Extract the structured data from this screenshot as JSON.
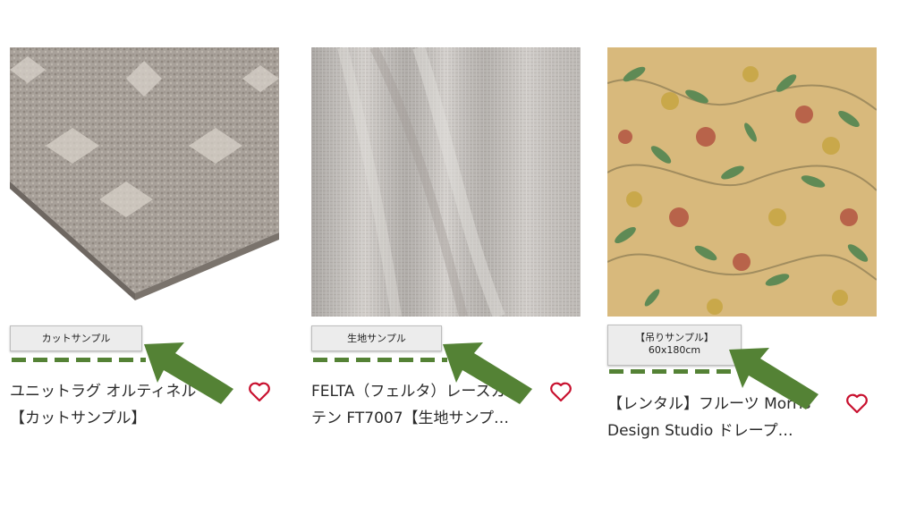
{
  "products": [
    {
      "sample_tag": "カットサンプル",
      "title_line1": "ユニットラグ オルティネル",
      "title_line2": "【カットサンプル】"
    },
    {
      "sample_tag": "生地サンプル",
      "title_line1": "FELTA（フェルタ）レースカー",
      "title_line2": "テン FT7007【生地サンプ…"
    },
    {
      "sample_tag": "【吊りサンプル】",
      "sample_tag_line2": "60x180cm",
      "title_line1": "【レンタル】フルーツ Morris",
      "title_line2": "Design Studio ドレープ…"
    }
  ],
  "icons": {
    "favorite": "heart-outline-icon",
    "pointer": "arrow-up-left-icon"
  },
  "colors": {
    "heart": "#c8102e",
    "annotation_green": "#548235"
  }
}
